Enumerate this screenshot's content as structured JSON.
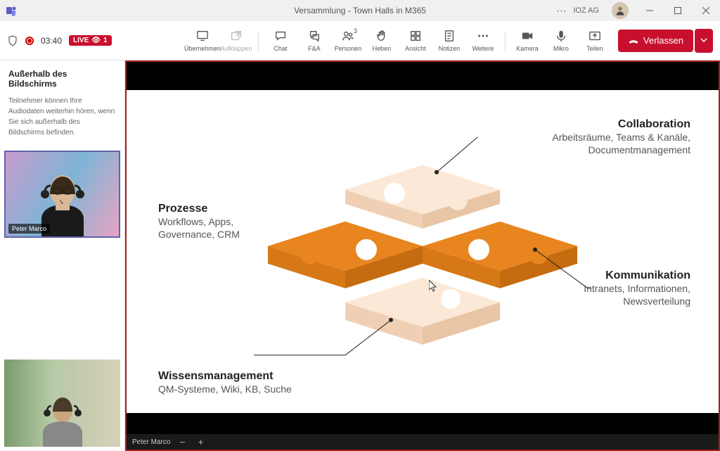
{
  "window": {
    "title": "Versammlung - Town Halls in M365",
    "org": "IOZ AG"
  },
  "meeting": {
    "timer": "03:40",
    "live_label": "LIVE",
    "viewers": "1"
  },
  "toolbar": {
    "uebernehmen": "Übernehmen",
    "aufklappen": "Aufklappen",
    "chat": "Chat",
    "fea": "F&A",
    "personen": "Personen",
    "personen_count": "3",
    "heben": "Heben",
    "ansicht": "Ansicht",
    "notizen": "Notizen",
    "weitere": "Weitere",
    "kamera": "Kamera",
    "mikro": "Mikro",
    "teilen": "Teilen",
    "verlassen": "Verlassen"
  },
  "sidebar": {
    "heading": "Außerhalb des Bildschirms",
    "desc": "Teilnehmer können Ihre Audiodaten weiterhin hören, wenn Sie sich außerhalb des Bildschirms befinden.",
    "participant1_name": "Peter Marco"
  },
  "slide": {
    "collab_title": "Collaboration",
    "collab_desc": "Arbeitsräume, Teams & Kanäle, Documentmanagement",
    "prozesse_title": "Prozesse",
    "prozesse_desc": "Workflows, Apps, Governance, CRM",
    "komm_title": "Kommunikation",
    "komm_desc": "Intranets, Informationen, Newsverteilung",
    "wissen_title": "Wissensmanagement",
    "wissen_desc": "QM-Systeme, Wiki, KB, Suche"
  },
  "footer": {
    "presenter": "Peter Marco",
    "zoom_out": "−",
    "zoom_in": "+"
  }
}
